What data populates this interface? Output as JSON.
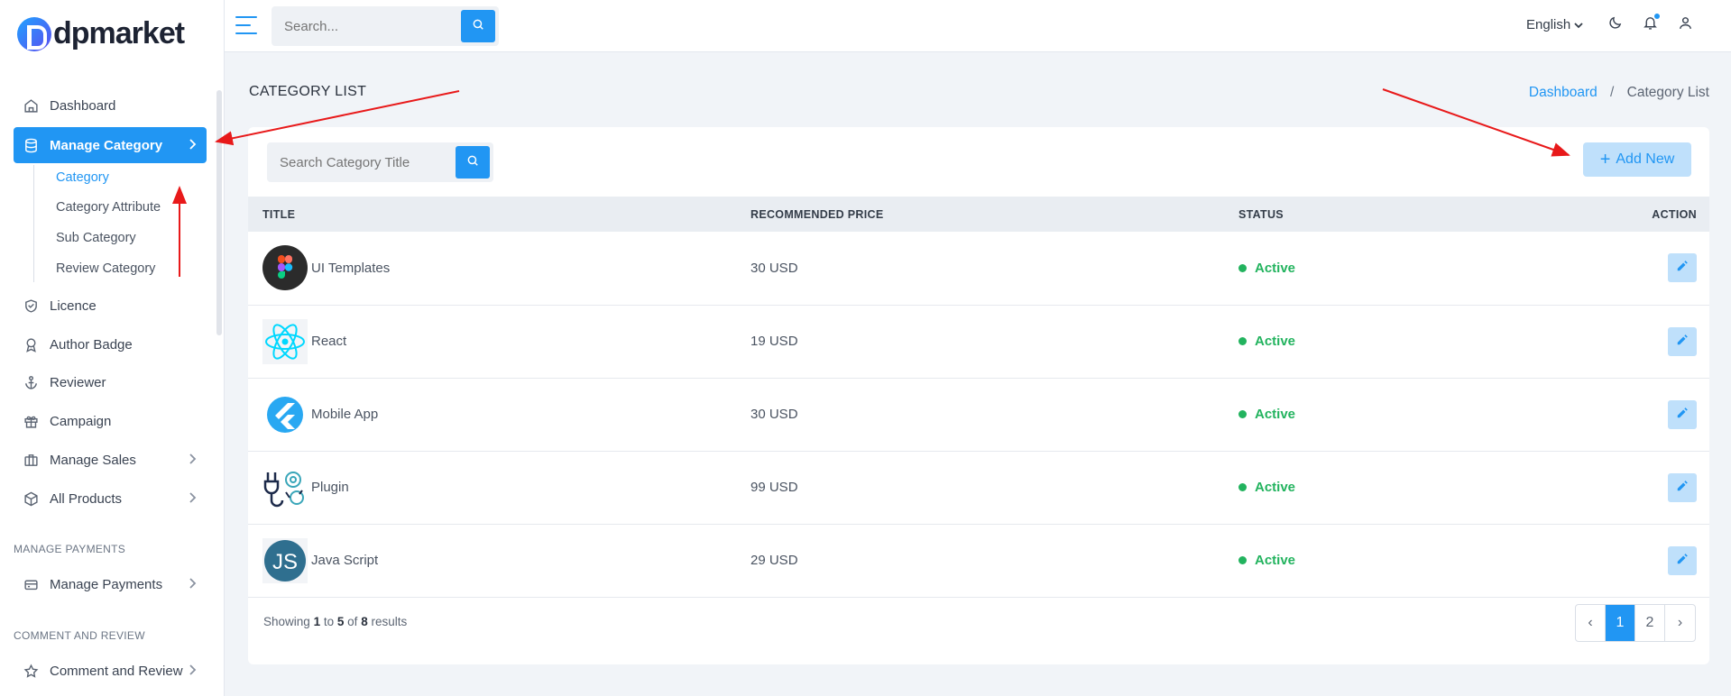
{
  "brand": {
    "name": "dpmarket"
  },
  "topbar": {
    "search_placeholder": "Search...",
    "language": "English"
  },
  "sidebar": {
    "items": [
      {
        "label": "Dashboard",
        "icon": "home-icon"
      },
      {
        "label": "Manage Category",
        "icon": "database-icon",
        "active": true
      },
      {
        "label": "Licence",
        "icon": "shield-icon"
      },
      {
        "label": "Author Badge",
        "icon": "badge-icon"
      },
      {
        "label": "Reviewer",
        "icon": "anchor-icon"
      },
      {
        "label": "Campaign",
        "icon": "gift-icon"
      },
      {
        "label": "Manage Sales",
        "icon": "briefcase-icon"
      },
      {
        "label": "All Products",
        "icon": "box-icon"
      },
      {
        "label": "Manage Payments",
        "icon": "payments-icon"
      },
      {
        "label": "Comment and Review",
        "icon": "star-icon"
      }
    ],
    "sub_items": [
      "Category",
      "Category Attribute",
      "Sub Category",
      "Review Category"
    ],
    "sections": [
      "MANAGE PAYMENTS",
      "COMMENT AND REVIEW"
    ]
  },
  "page": {
    "title": "CATEGORY LIST",
    "breadcrumb": [
      "Dashboard",
      "/",
      "Category List"
    ]
  },
  "card": {
    "search_placeholder": "Search Category Title",
    "add_label": "Add New",
    "columns": [
      "TITLE",
      "RECOMMENDED PRICE",
      "STATUS",
      "ACTION"
    ],
    "rows": [
      {
        "title": "UI Templates",
        "price": "30 USD",
        "status": "Active",
        "icon": "figma-icon"
      },
      {
        "title": "React",
        "price": "19 USD",
        "status": "Active",
        "icon": "react-icon"
      },
      {
        "title": "Mobile App",
        "price": "30 USD",
        "status": "Active",
        "icon": "flutter-icon"
      },
      {
        "title": "Plugin",
        "price": "99 USD",
        "status": "Active",
        "icon": "plugin-icon"
      },
      {
        "title": "Java Script",
        "price": "29 USD",
        "status": "Active",
        "icon": "javascript-icon"
      }
    ],
    "footer": {
      "showing": "Showing",
      "from": "1",
      "to_word": "to",
      "to": "5",
      "of_word": "of",
      "total": "8",
      "results": "results"
    },
    "pagination": {
      "prev": "‹",
      "pages": [
        "1",
        "2"
      ],
      "next": "›",
      "current": "1"
    }
  },
  "colors": {
    "accent": "#2196f3",
    "active_status": "#22b35e",
    "annotation": "#e8191a"
  }
}
